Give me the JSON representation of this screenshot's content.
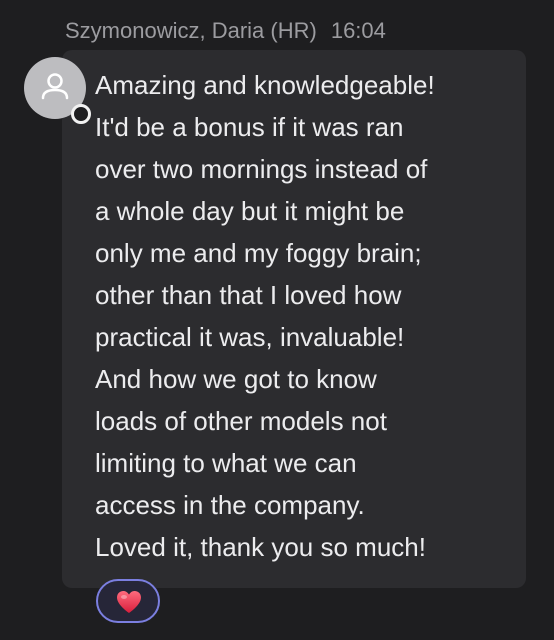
{
  "message": {
    "sender": "Szymonowicz, Daria (HR)",
    "time": "16:04",
    "lines": [
      "Amazing and knowledgeable!",
      "It'd be a bonus if it was ran",
      "over two mornings instead of",
      "a whole day but it might be",
      "only me and my foggy brain;",
      "other than that I loved how",
      "practical it was, invaluable!",
      "And how we got to know",
      "loads of other models not",
      "limiting to what we can",
      "access in the company.",
      "Loved it, thank you so much!"
    ]
  },
  "avatar": {
    "icon": "person-icon",
    "status_icon": "presence-status-icon"
  },
  "reaction": {
    "icon": "heart-icon",
    "color": "#e8324a",
    "selected_border": "#7b7fe0"
  },
  "colors": {
    "background": "#1e1e20",
    "bubble": "#2c2c2f",
    "text": "#ececee",
    "header_text": "#9c9ca0"
  }
}
